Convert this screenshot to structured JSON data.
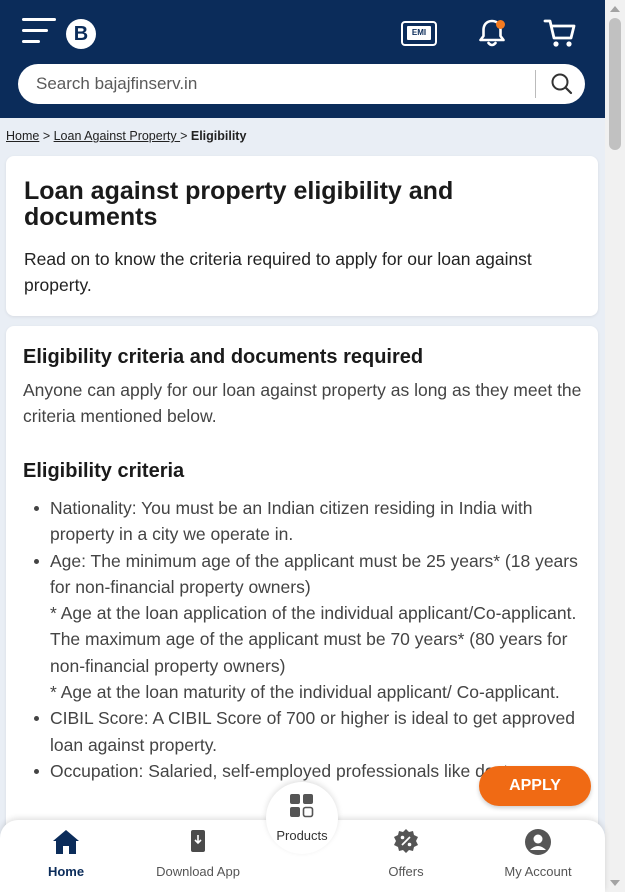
{
  "header": {
    "logo_text": "B",
    "emi_label": "EMI",
    "search_placeholder": "Search bajajfinserv.in"
  },
  "breadcrumb": {
    "home": "Home",
    "sep1": " > ",
    "loan": "Loan Against Property ",
    "sep2": " > ",
    "current": "Eligibility"
  },
  "intro_card": {
    "title": "Loan against property eligibility and documents",
    "description": "Read on to know the criteria required to apply for our loan against property."
  },
  "eligibility_card": {
    "heading": "Eligibility criteria and documents required",
    "intro": "Anyone can apply for our loan against property as long as they meet the criteria mentioned below.",
    "criteria_heading": "Eligibility criteria",
    "criteria": [
      "Nationality: You must be an Indian citizen residing in India with property in a city we operate in.",
      "Age: The minimum age of the applicant must be 25 years* (18 years for non-financial property owners)",
      "* Age at the loan application of the individual applicant/Co-applicant.",
      "The maximum age of the applicant must be 70 years* (80 years for non-financial property owners)",
      "* Age at the loan maturity of the individual applicant/ Co-applicant.",
      "CIBIL Score: A CIBIL Score of 700 or higher is ideal to get approved loan against property.",
      "Occupation: Salaried, self-employed professionals like doctors"
    ]
  },
  "apply_label": "APPLY",
  "bottom_nav": {
    "home": "Home",
    "download": "Download App",
    "products": "Products",
    "offers": "Offers",
    "account": "My Account"
  },
  "colors": {
    "brand_navy": "#0b2c5a",
    "accent_orange": "#f06a14",
    "notification_dot": "#f47b20"
  }
}
